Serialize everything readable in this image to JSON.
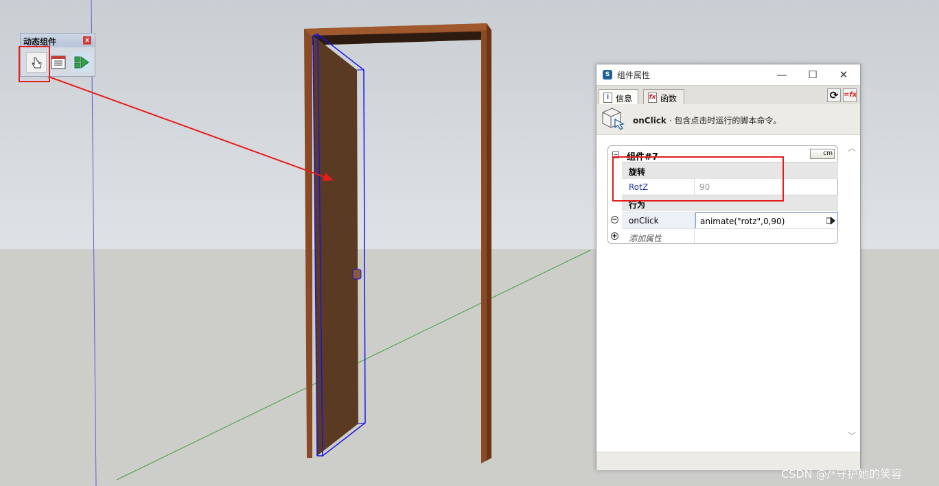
{
  "toolbar": {
    "title": "动态组件",
    "close": "x",
    "buttons": [
      {
        "name": "interact-tool"
      },
      {
        "name": "component-options"
      },
      {
        "name": "component-attributes"
      }
    ]
  },
  "window": {
    "title": "组件属性",
    "controls": {
      "minimize": "—",
      "maximize": "☐",
      "close": "✕"
    },
    "tabs": [
      {
        "label": "信息",
        "icon": "i",
        "active": true
      },
      {
        "label": "函数",
        "icon": "fx",
        "active": false
      }
    ],
    "refresh": "⟳",
    "fx": "=fx",
    "info": {
      "keyword": "onClick",
      "text": " · 包含点击时运行的脚本命令。"
    },
    "component": {
      "collapse": "−",
      "title": "组件#7",
      "units": "cm",
      "sections": [
        {
          "label": "旋转"
        },
        {
          "label": "行为"
        }
      ],
      "rows": [
        {
          "name": "RotZ",
          "value": "90"
        },
        {
          "name": "onClick",
          "value": "animate(\"rotz\",0,90)"
        },
        {
          "name": "添加属性",
          "value": ""
        }
      ],
      "row_buttons": {
        "remove": "−",
        "add": "+"
      }
    },
    "scroll": {
      "up": "︿",
      "down": "﹀"
    }
  },
  "watermark": "CSDN @/*守护她的笑容",
  "colors": {
    "annotation": "#e51c1c",
    "door": "#5a3a22",
    "frame": "#8a4a25",
    "selection": "#1515e6"
  }
}
